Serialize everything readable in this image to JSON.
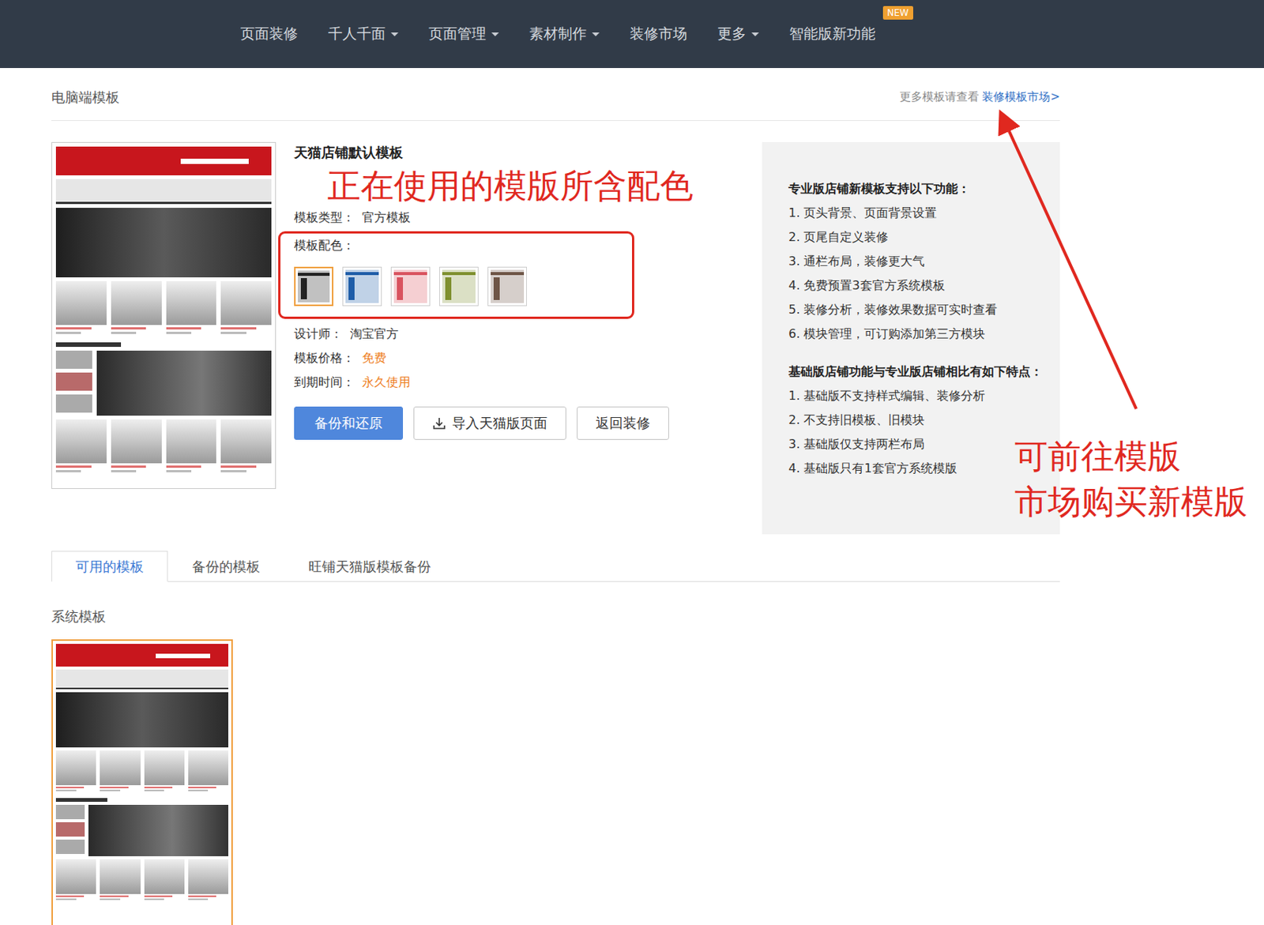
{
  "nav": {
    "items": [
      {
        "label": "页面装修",
        "has_menu": false
      },
      {
        "label": "千人千面",
        "has_menu": true
      },
      {
        "label": "页面管理",
        "has_menu": true
      },
      {
        "label": "素材制作",
        "has_menu": true
      },
      {
        "label": "装修市场",
        "has_menu": false
      },
      {
        "label": "更多",
        "has_menu": true
      },
      {
        "label": "智能版新功能",
        "has_menu": false
      }
    ],
    "badge": "NEW"
  },
  "header": {
    "title": "电脑端模板",
    "hint": "更多模板请查看",
    "link": "装修模板市场>"
  },
  "current": {
    "name": "天猫店铺默认模板",
    "type": {
      "label": "模板类型：",
      "value": "官方模板",
      "highlight": false
    },
    "color_label": "模板配色：",
    "swatches": [
      {
        "color": "#222222",
        "selected": true
      },
      {
        "color": "#1f5da8",
        "selected": false
      },
      {
        "color": "#d9535f",
        "selected": false
      },
      {
        "color": "#7f902f",
        "selected": false
      },
      {
        "color": "#6e5546",
        "selected": false
      }
    ],
    "details": [
      {
        "label": "设计师：",
        "value": "淘宝官方",
        "highlight": false
      },
      {
        "label": "模板价格：",
        "value": "免费",
        "highlight": true
      },
      {
        "label": "到期时间：",
        "value": "永久使用",
        "highlight": true
      }
    ],
    "buttons": [
      {
        "label": "备份和还原",
        "kind": "primary"
      },
      {
        "label": "导入天猫版页面",
        "kind": "import"
      },
      {
        "label": "返回装修",
        "kind": "plain"
      }
    ]
  },
  "features": {
    "pro_title": "专业版店铺新模板支持以下功能：",
    "pro_items": [
      "1. 页头背景、页面背景设置",
      "2. 页尾自定义装修",
      "3. 通栏布局，装修更大气",
      "4. 免费预置3套官方系统模板",
      "5. 装修分析，装修效果数据可实时查看",
      "6. 模块管理，可订购添加第三方模块"
    ],
    "basic_title": "基础版店铺功能与专业版店铺相比有如下特点：",
    "basic_items": [
      "1. 基础版不支持样式编辑、装修分析",
      "2. 不支持旧模板、旧模块",
      "3. 基础版仅支持两栏布局",
      "4. 基础版只有1套官方系统模版"
    ]
  },
  "annotations": {
    "colors": "正在使用的模版所含配色",
    "market": [
      "可前往模版",
      "市场购买新模版"
    ]
  },
  "tabs": [
    {
      "label": "可用的模板",
      "selected": true
    },
    {
      "label": "备份的模板",
      "selected": false
    },
    {
      "label": "旺铺天猫版模板备份",
      "selected": false
    }
  ],
  "section_title": "系统模板",
  "system_templates": [
    {
      "selected": true
    }
  ]
}
